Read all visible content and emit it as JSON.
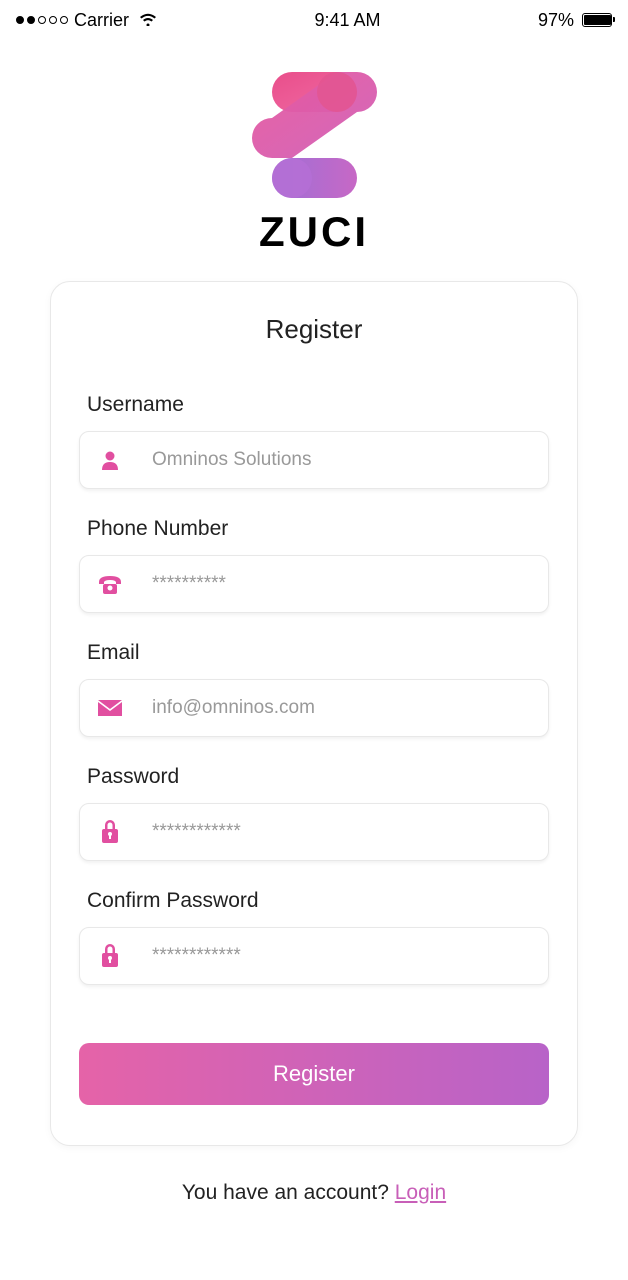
{
  "status_bar": {
    "carrier": "Carrier",
    "time": "9:41 AM",
    "battery_percent": "97%"
  },
  "brand": {
    "name": "ZUCI"
  },
  "card": {
    "title": "Register",
    "fields": {
      "username": {
        "label": "Username",
        "placeholder": "Omninos Solutions",
        "icon": "user-icon"
      },
      "phone": {
        "label": "Phone Number",
        "placeholder": "**********",
        "icon": "phone-icon"
      },
      "email": {
        "label": "Email",
        "placeholder": "info@omninos.com",
        "icon": "mail-icon"
      },
      "password": {
        "label": "Password",
        "placeholder": "************",
        "icon": "lock-icon"
      },
      "confirm_password": {
        "label": "Confirm Password",
        "placeholder": "************",
        "icon": "lock-icon"
      }
    },
    "submit_label": "Register"
  },
  "footer": {
    "prompt": "You have an account? ",
    "link_text": "Login"
  },
  "colors": {
    "accent": "#e14fa0",
    "gradient_start": "#e563a8",
    "gradient_end": "#b863c8"
  }
}
